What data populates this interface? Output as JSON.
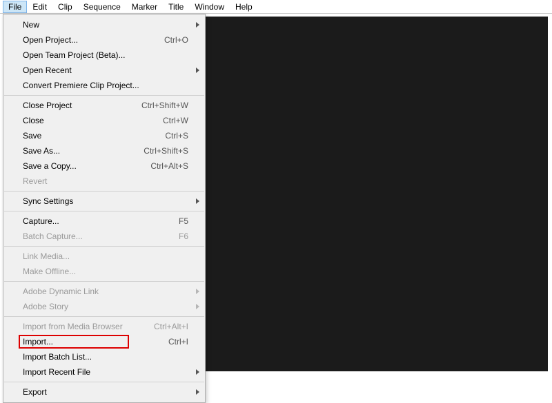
{
  "menubar": {
    "items": [
      "File",
      "Edit",
      "Clip",
      "Sequence",
      "Marker",
      "Title",
      "Window",
      "Help"
    ],
    "activeIndex": 0
  },
  "fileMenu": {
    "groups": [
      [
        {
          "label": "New",
          "shortcut": "",
          "hasSubmenu": true,
          "disabled": false,
          "highlighted": false
        },
        {
          "label": "Open Project...",
          "shortcut": "Ctrl+O",
          "hasSubmenu": false,
          "disabled": false,
          "highlighted": false
        },
        {
          "label": "Open Team Project (Beta)...",
          "shortcut": "",
          "hasSubmenu": false,
          "disabled": false,
          "highlighted": false
        },
        {
          "label": "Open Recent",
          "shortcut": "",
          "hasSubmenu": true,
          "disabled": false,
          "highlighted": false
        },
        {
          "label": "Convert Premiere Clip Project...",
          "shortcut": "",
          "hasSubmenu": false,
          "disabled": false,
          "highlighted": false
        }
      ],
      [
        {
          "label": "Close Project",
          "shortcut": "Ctrl+Shift+W",
          "hasSubmenu": false,
          "disabled": false,
          "highlighted": false
        },
        {
          "label": "Close",
          "shortcut": "Ctrl+W",
          "hasSubmenu": false,
          "disabled": false,
          "highlighted": false
        },
        {
          "label": "Save",
          "shortcut": "Ctrl+S",
          "hasSubmenu": false,
          "disabled": false,
          "highlighted": false
        },
        {
          "label": "Save As...",
          "shortcut": "Ctrl+Shift+S",
          "hasSubmenu": false,
          "disabled": false,
          "highlighted": false
        },
        {
          "label": "Save a Copy...",
          "shortcut": "Ctrl+Alt+S",
          "hasSubmenu": false,
          "disabled": false,
          "highlighted": false
        },
        {
          "label": "Revert",
          "shortcut": "",
          "hasSubmenu": false,
          "disabled": true,
          "highlighted": false
        }
      ],
      [
        {
          "label": "Sync Settings",
          "shortcut": "",
          "hasSubmenu": true,
          "disabled": false,
          "highlighted": false
        }
      ],
      [
        {
          "label": "Capture...",
          "shortcut": "F5",
          "hasSubmenu": false,
          "disabled": false,
          "highlighted": false
        },
        {
          "label": "Batch Capture...",
          "shortcut": "F6",
          "hasSubmenu": false,
          "disabled": true,
          "highlighted": false
        }
      ],
      [
        {
          "label": "Link Media...",
          "shortcut": "",
          "hasSubmenu": false,
          "disabled": true,
          "highlighted": false
        },
        {
          "label": "Make Offline...",
          "shortcut": "",
          "hasSubmenu": false,
          "disabled": true,
          "highlighted": false
        }
      ],
      [
        {
          "label": "Adobe Dynamic Link",
          "shortcut": "",
          "hasSubmenu": true,
          "disabled": true,
          "highlighted": false
        },
        {
          "label": "Adobe Story",
          "shortcut": "",
          "hasSubmenu": true,
          "disabled": true,
          "highlighted": false
        }
      ],
      [
        {
          "label": "Import from Media Browser",
          "shortcut": "Ctrl+Alt+I",
          "hasSubmenu": false,
          "disabled": true,
          "highlighted": false
        },
        {
          "label": "Import...",
          "shortcut": "Ctrl+I",
          "hasSubmenu": false,
          "disabled": false,
          "highlighted": true
        },
        {
          "label": "Import Batch List...",
          "shortcut": "",
          "hasSubmenu": false,
          "disabled": false,
          "highlighted": false
        },
        {
          "label": "Import Recent File",
          "shortcut": "",
          "hasSubmenu": true,
          "disabled": false,
          "highlighted": false
        }
      ],
      [
        {
          "label": "Export",
          "shortcut": "",
          "hasSubmenu": true,
          "disabled": false,
          "highlighted": false
        }
      ]
    ]
  }
}
